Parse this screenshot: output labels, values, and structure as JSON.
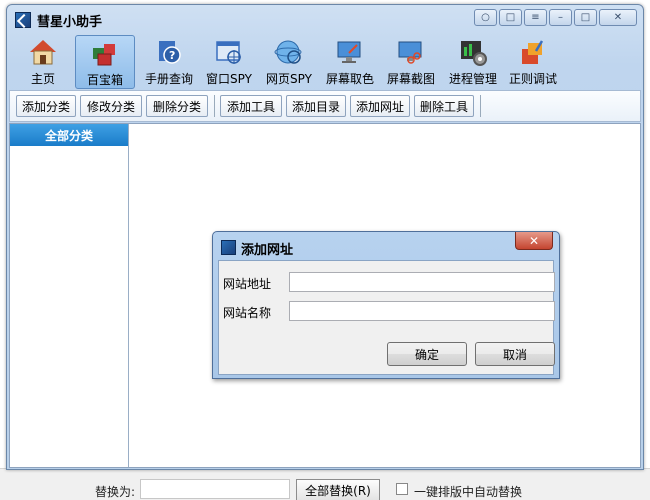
{
  "window": {
    "title": "彗星小助手"
  },
  "toolbar": {
    "items": [
      {
        "label": "主页",
        "icon": "home-icon"
      },
      {
        "label": "百宝箱",
        "icon": "toolbox-icon"
      },
      {
        "label": "手册查询",
        "icon": "help-book-icon"
      },
      {
        "label": "窗口SPY",
        "icon": "window-spy-icon"
      },
      {
        "label": "网页SPY",
        "icon": "web-spy-icon"
      },
      {
        "label": "屏幕取色",
        "icon": "color-picker-icon"
      },
      {
        "label": "屏幕截图",
        "icon": "screenshot-icon"
      },
      {
        "label": "进程管理",
        "icon": "process-gear-icon"
      },
      {
        "label": "正则调试",
        "icon": "regex-debug-icon"
      }
    ]
  },
  "subtoolbar": {
    "add_category": "添加分类",
    "edit_category": "修改分类",
    "delete_category": "删除分类",
    "add_tool": "添加工具",
    "add_directory": "添加目录",
    "add_url": "添加网址",
    "delete_tool": "删除工具"
  },
  "sidebar": {
    "all_categories": "全部分类"
  },
  "dialog": {
    "title": "添加网址",
    "url_label": "网站地址",
    "name_label": "网站名称",
    "url_value": "",
    "name_value": "",
    "ok": "确定",
    "cancel": "取消"
  },
  "background_app": {
    "replace_label": "替换为:",
    "replace_all": "全部替换(R)",
    "auto_replace": "一键排版中自动替换"
  }
}
